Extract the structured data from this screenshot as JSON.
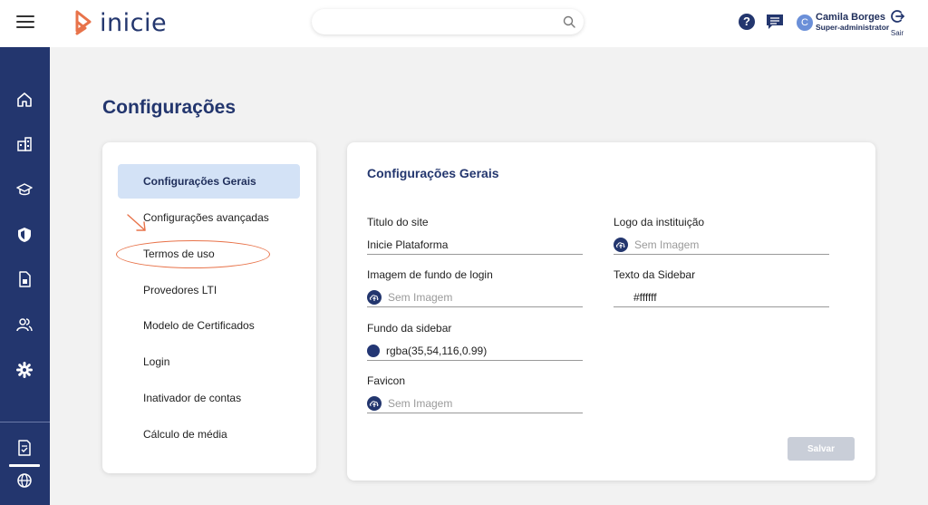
{
  "header": {
    "brand": "inicie",
    "search": {
      "value": "",
      "placeholder": ""
    },
    "help_label": "?",
    "user": {
      "initial": "C",
      "name": "Camila Borges",
      "role": "Super-administrator"
    },
    "logout_label": "Sair"
  },
  "page": {
    "title": "Configurações"
  },
  "menu": {
    "items": [
      {
        "label": "Configurações Gerais"
      },
      {
        "label": "Configurações avançadas"
      },
      {
        "label": "Termos de uso"
      },
      {
        "label": "Provedores LTI"
      },
      {
        "label": "Modelo de Certificados"
      },
      {
        "label": "Login"
      },
      {
        "label": "Inativador de contas"
      },
      {
        "label": "Cálculo de média"
      }
    ]
  },
  "form": {
    "title": "Configurações Gerais",
    "site_title": {
      "label": "Titulo do site",
      "value": "Inicie Plataforma"
    },
    "login_bg": {
      "label": "Imagem de fundo de login",
      "placeholder": "Sem Imagem"
    },
    "sidebar_bg": {
      "label": "Fundo da sidebar",
      "value": "rgba(35,54,116,0.99)"
    },
    "favicon": {
      "label": "Favicon",
      "placeholder": "Sem Imagem"
    },
    "institution_logo": {
      "label": "Logo da instituição",
      "placeholder": "Sem Imagem"
    },
    "sidebar_text": {
      "label": "Texto da Sidebar",
      "value": "#ffffff"
    },
    "save_label": "Salvar"
  },
  "colors": {
    "primary": "#23366e",
    "accent": "#e8734a",
    "active_menu": "#d3e2f6"
  }
}
